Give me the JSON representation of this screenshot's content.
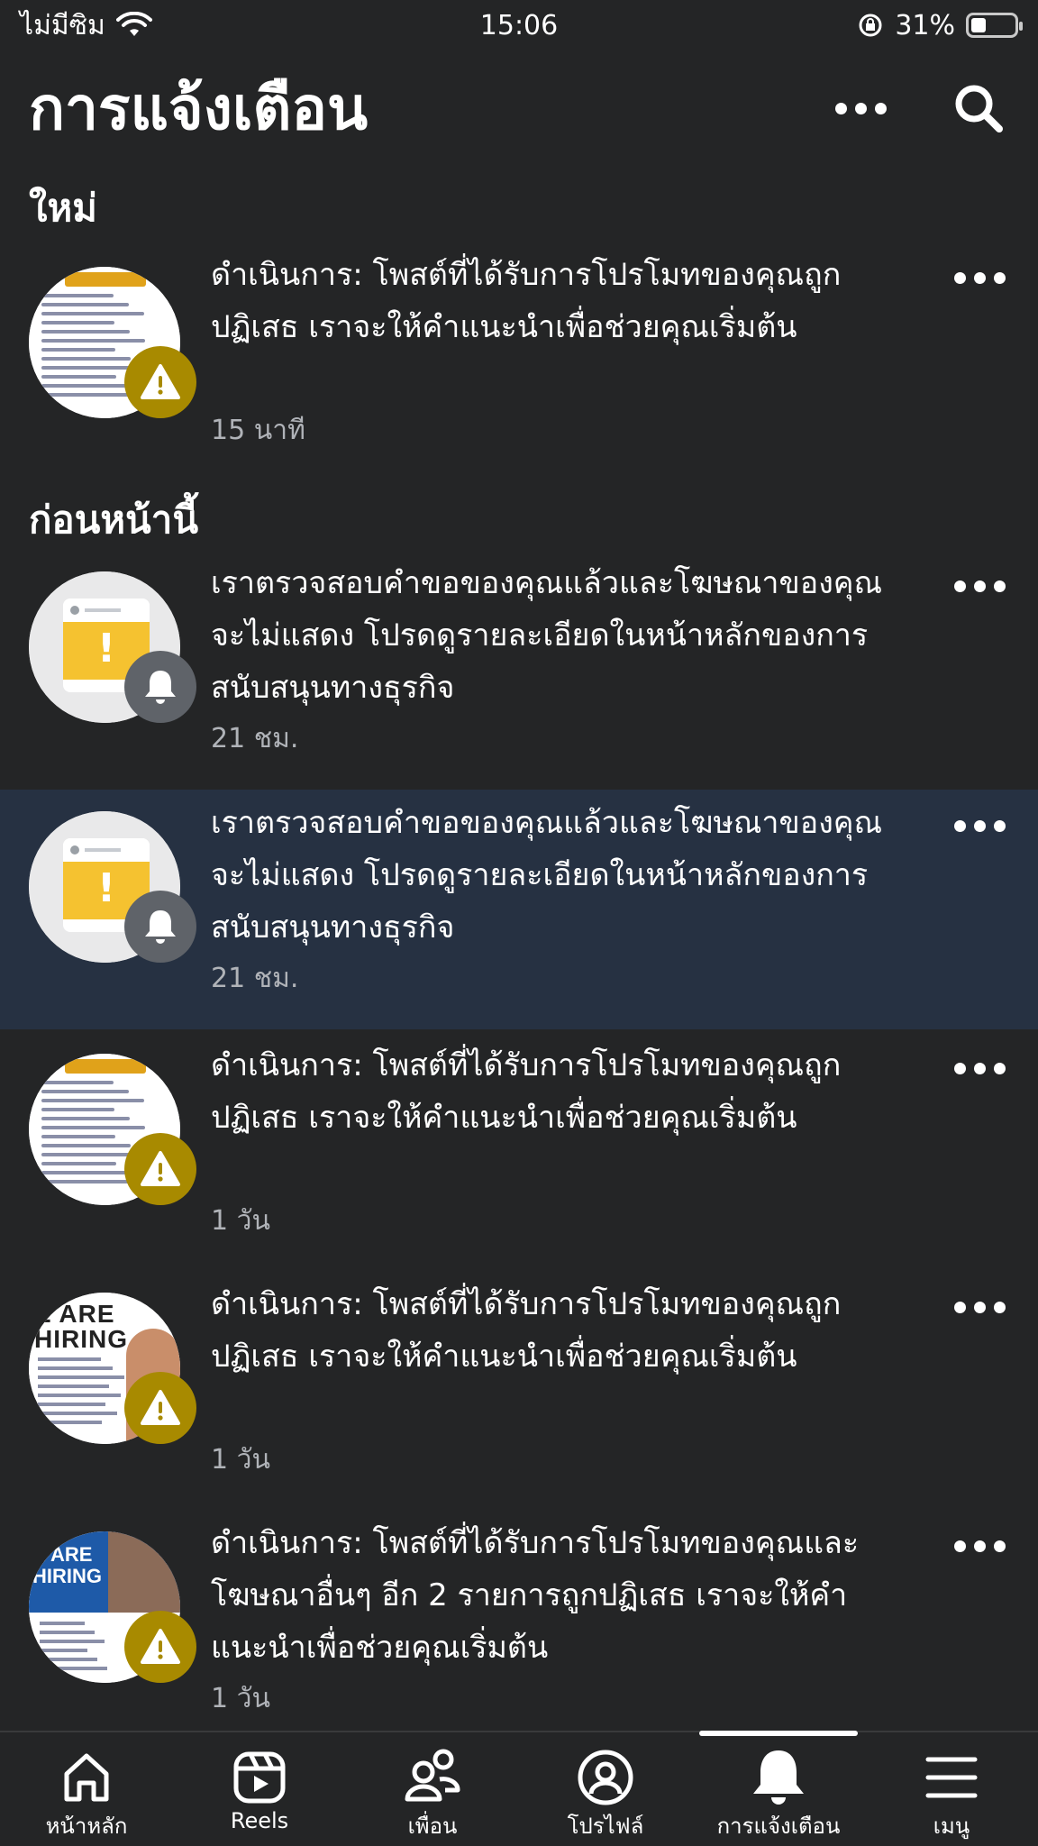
{
  "status_bar": {
    "carrier": "ไม่มีซิม",
    "time": "15:06",
    "battery": "31%",
    "battery_level": 0.31
  },
  "header": {
    "title": "การแจ้งเตือน"
  },
  "sections": {
    "new_label": "ใหม่",
    "earlier_label": "ก่อนหน้านี้"
  },
  "notifications": [
    {
      "text": "ดำเนินการ: โพสต์ที่ได้รับการโปรโมทของคุณถูกปฏิเสธ เราจะให้คำแนะนำเพื่อช่วยคุณเริ่มต้น",
      "time": "15 นาที",
      "badge": "warning-icon",
      "thumbnail": "document",
      "highlighted": false
    },
    {
      "text": "เราตรวจสอบคำขอของคุณแล้วและโฆษณาของคุณจะไม่แสดง โปรดดูรายละเอียดในหน้าหลักของการสนับสนุนทางธุรกิจ",
      "time": "21 ชม.",
      "badge": "bell-icon",
      "thumbnail": "ad-card",
      "highlighted": false
    },
    {
      "text": "เราตรวจสอบคำขอของคุณแล้วและโฆษณาของคุณจะไม่แสดง โปรดดูรายละเอียดในหน้าหลักของการสนับสนุนทางธุรกิจ",
      "time": "21 ชม.",
      "badge": "bell-icon",
      "thumbnail": "ad-card",
      "highlighted": true
    },
    {
      "text": "ดำเนินการ: โพสต์ที่ได้รับการโปรโมทของคุณถูกปฏิเสธ เราจะให้คำแนะนำเพื่อช่วยคุณเริ่มต้น",
      "time": "1 วัน",
      "badge": "warning-icon",
      "thumbnail": "document",
      "highlighted": false
    },
    {
      "text": "ดำเนินการ: โพสต์ที่ได้รับการโปรโมทของคุณถูกปฏิเสธ เราจะให้คำแนะนำเพื่อช่วยคุณเริ่มต้น",
      "time": "1 วัน",
      "badge": "warning-icon",
      "thumbnail": "hiring-white",
      "thumbnail_text": "E ARE HIRING",
      "highlighted": false
    },
    {
      "text": "ดำเนินการ: โพสต์ที่ได้รับการโปรโมทของคุณและโฆษณาอื่นๆ อีก 2 รายการถูกปฏิเสธ เราจะให้คำแนะนำเพื่อช่วยคุณเริ่มต้น",
      "time": "1 วัน",
      "badge": "warning-icon",
      "thumbnail": "hiring-blue",
      "thumbnail_text": "E ARE HIRING",
      "highlighted": false
    }
  ],
  "bottom_nav": [
    {
      "label": "หน้าหลัก",
      "icon": "home-icon",
      "active": false
    },
    {
      "label": "Reels",
      "icon": "reels-icon",
      "active": false
    },
    {
      "label": "เพื่อน",
      "icon": "friends-icon",
      "active": false
    },
    {
      "label": "โปรไฟล์",
      "icon": "profile-icon",
      "active": false
    },
    {
      "label": "การแจ้งเตือน",
      "icon": "bell-icon",
      "active": true
    },
    {
      "label": "เมนู",
      "icon": "menu-icon",
      "active": false
    }
  ],
  "colors": {
    "background": "#242526",
    "highlight": "#263142",
    "warning_badge": "#a88a00",
    "bell_badge": "#5f6369",
    "secondary_text": "#b0b3b8"
  }
}
